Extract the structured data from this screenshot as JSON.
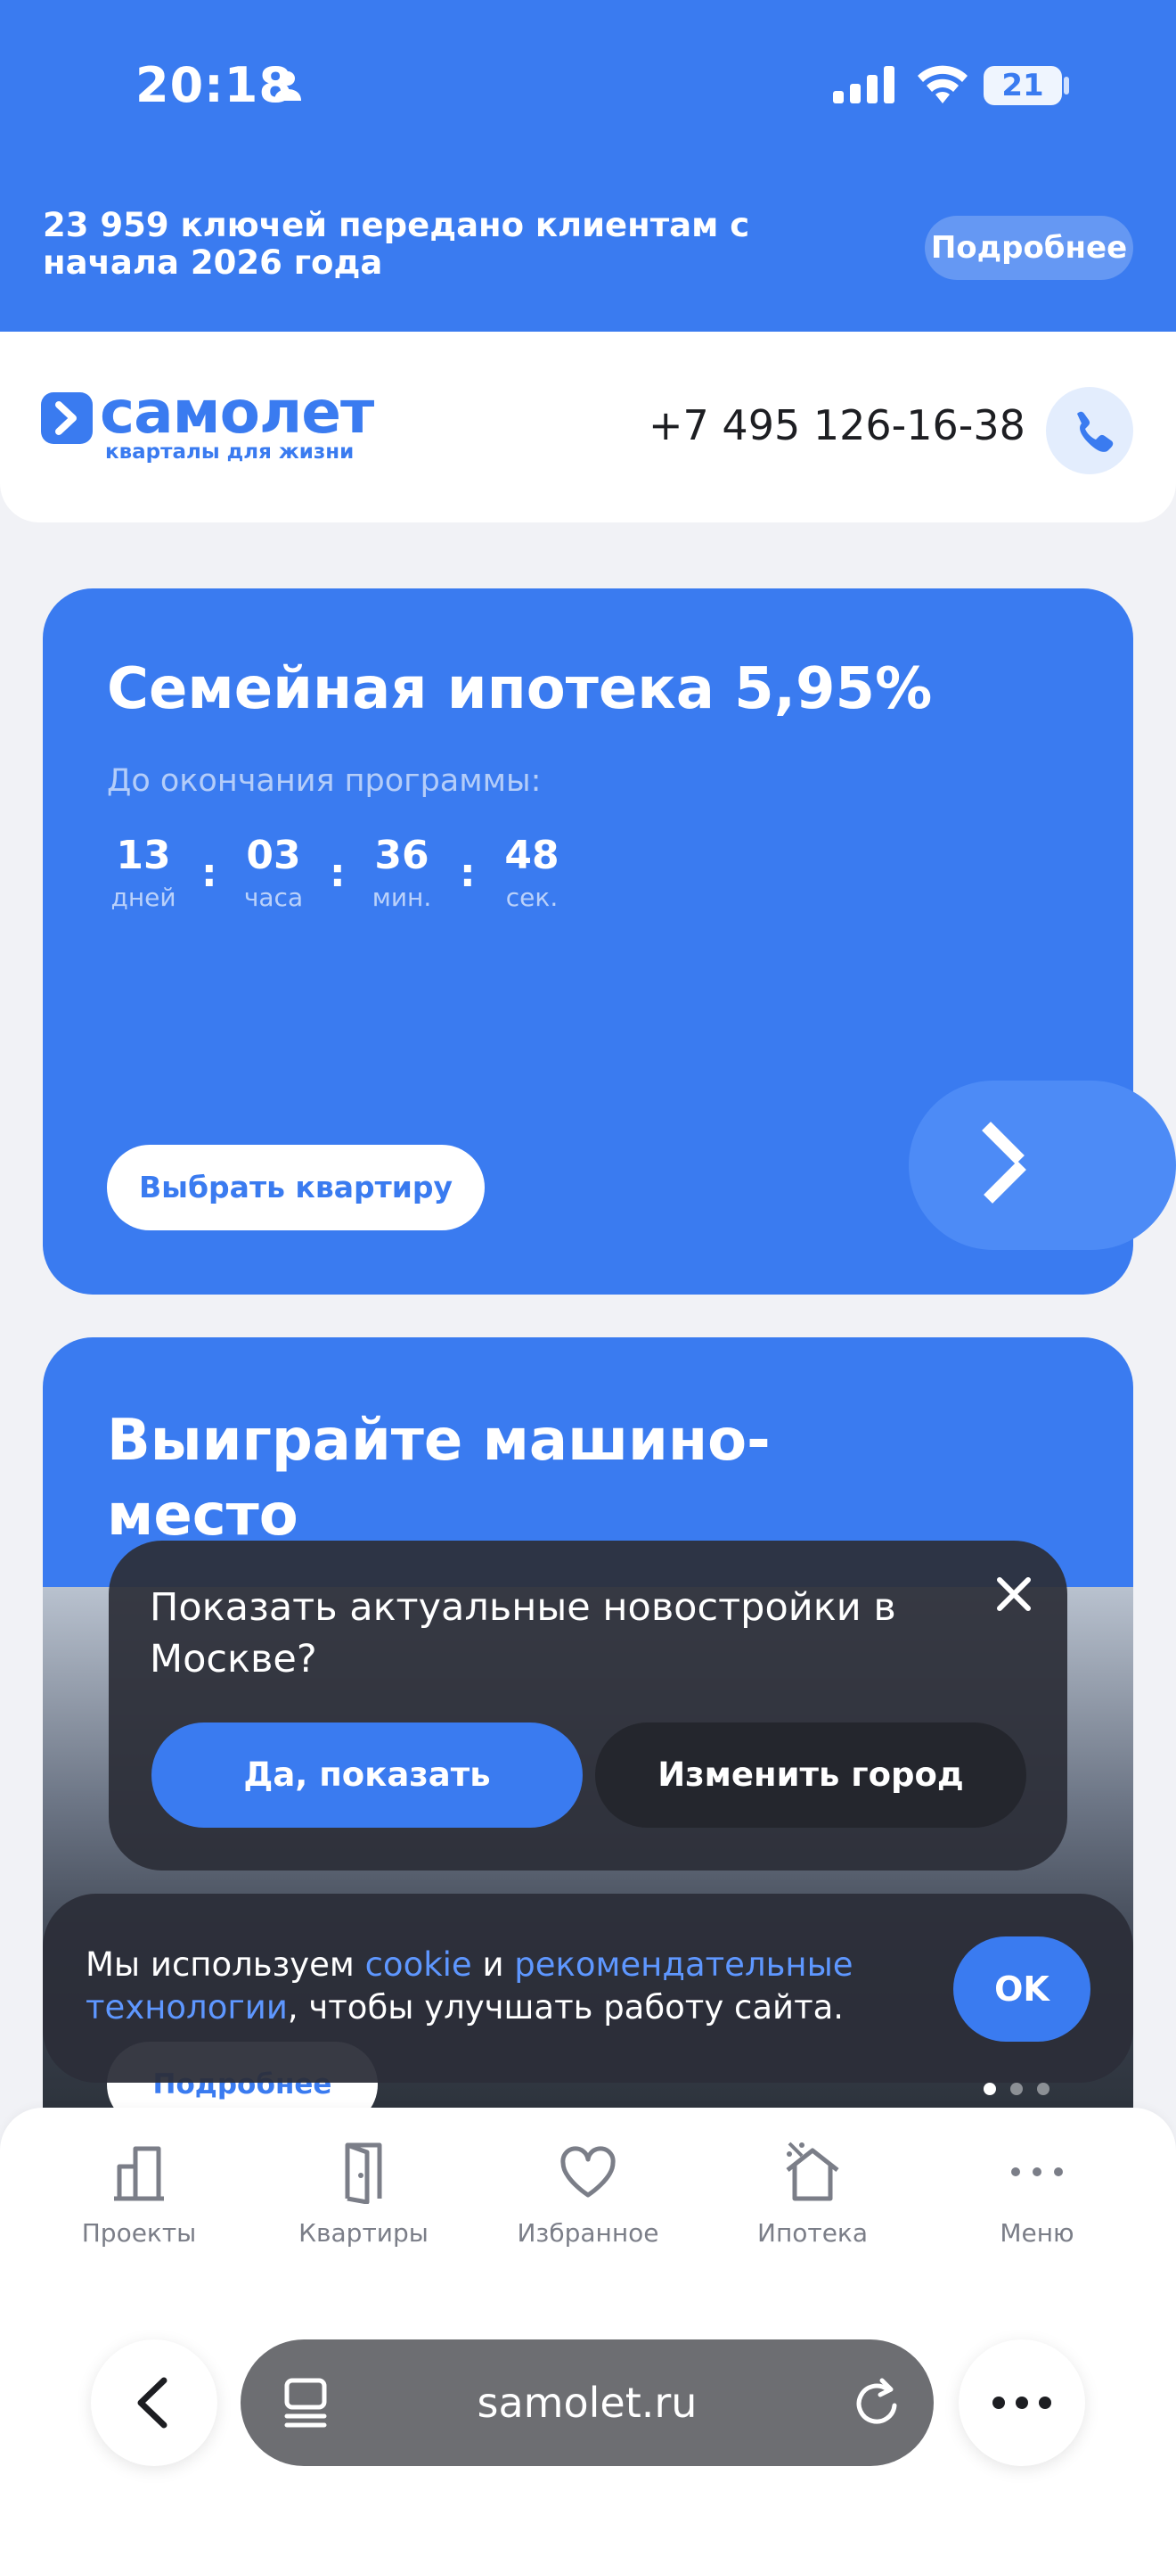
{
  "status_bar": {
    "time": "20:18",
    "battery": "21"
  },
  "promo_banner": {
    "text": "23 959 ключей передано клиентам с начала 2026 года",
    "button": "Подробнее"
  },
  "header": {
    "logo_word": "самолет",
    "logo_tagline": "кварталы для жизни",
    "phone": "+7 495 126-16-38"
  },
  "card_mortgage": {
    "title": "Семейная ипотека 5,95%",
    "subtitle": "До окончания программы:",
    "countdown": [
      {
        "value": "13",
        "unit": "дней"
      },
      {
        "value": "03",
        "unit": "часа"
      },
      {
        "value": "36",
        "unit": "мин."
      },
      {
        "value": "48",
        "unit": "сек."
      }
    ],
    "separator": ":",
    "button": "Выбрать квартиру"
  },
  "card_parking": {
    "title": "Выиграйте машино-место",
    "button": "Подробнее",
    "slides_total": 3,
    "slide_active": 1
  },
  "city_popup": {
    "question": "Показать актуальные новостройки в Москве?",
    "confirm": "Да, показать",
    "change": "Изменить город"
  },
  "cookie_banner": {
    "prefix": "Мы используем ",
    "link1": "cookie",
    "middle": " и ",
    "link2": "рекомендательные технологии",
    "suffix": ", чтобы улучшать работу сайта.",
    "ok": "OK"
  },
  "bottom_nav": {
    "items": [
      {
        "label": "Проекты",
        "icon": "buildings-icon"
      },
      {
        "label": "Квартиры",
        "icon": "door-icon"
      },
      {
        "label": "Избранное",
        "icon": "heart-icon"
      },
      {
        "label": "Ипотека",
        "icon": "house-percent-icon"
      },
      {
        "label": "Меню",
        "icon": "more-dots-icon"
      }
    ]
  },
  "browser": {
    "url": "samolet.ru"
  },
  "colors": {
    "brand": "#3a7bf0",
    "dark_overlay": "#2c2e38",
    "text_dark": "#1d1e22",
    "muted": "#7b7e88"
  }
}
